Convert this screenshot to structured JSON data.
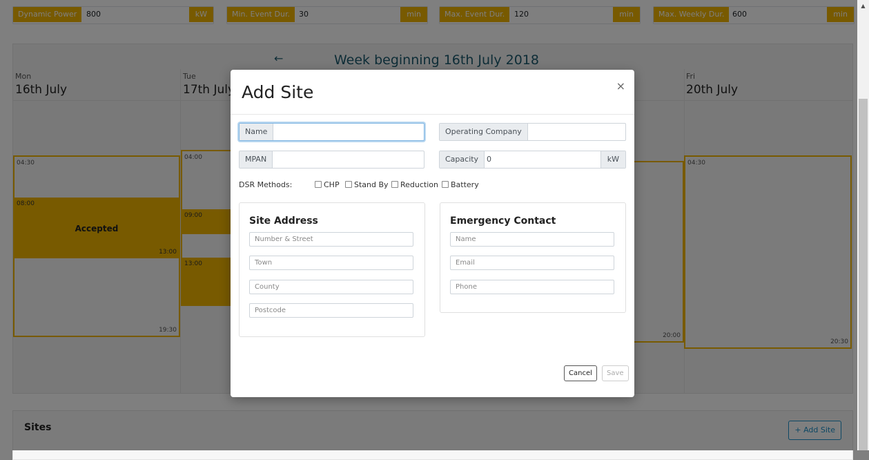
{
  "params": {
    "dynamic_power_label": "Dynamic Power",
    "dynamic_power_value": "800",
    "dynamic_power_unit": "kW",
    "min_event_label": "Min. Event Dur.",
    "min_event_value": "30",
    "min_event_unit": "min",
    "max_event_label": "Max. Event Dur.",
    "max_event_value": "120",
    "max_event_unit": "min",
    "max_weekly_label": "Max. Weekly Dur.",
    "max_weekly_value": "600",
    "max_weekly_unit": "min"
  },
  "calendar": {
    "back_arrow": "←",
    "title": "Week beginning 16th July 2018",
    "days": [
      {
        "name": "Mon",
        "date": "16th July"
      },
      {
        "name": "Tue",
        "date": "17th July"
      },
      {
        "name": "Fri",
        "date": "20th July"
      }
    ],
    "mon": {
      "e1_start": "04:30",
      "e2_start": "08:00",
      "e2_status": "Accepted",
      "e2_end": "13:00",
      "e3_end": "19:30"
    },
    "tue": {
      "e1_start": "04:00",
      "e2_start": "09:00",
      "e3_start": "13:00"
    },
    "thu": {
      "end": "20:00"
    },
    "fri": {
      "start": "04:30",
      "end": "20:30"
    }
  },
  "sites": {
    "title": "Sites",
    "add_button": "+ Add Site"
  },
  "modal": {
    "title": "Add Site",
    "close": "×",
    "name_label": "Name",
    "name_value": "",
    "operating_company_label": "Operating Company",
    "operating_company_value": "",
    "mpan_label": "MPAN",
    "mpan_value": "",
    "capacity_label": "Capacity",
    "capacity_value": "0",
    "capacity_unit": "kW",
    "dsr_label": "DSR Methods:",
    "dsr_methods": [
      "CHP",
      "Stand By",
      "Reduction",
      "Battery"
    ],
    "site_address": {
      "title": "Site Address",
      "fields": [
        "Number & Street",
        "Town",
        "County",
        "Postcode"
      ]
    },
    "emergency_contact": {
      "title": "Emergency Contact",
      "fields": [
        "Name",
        "Email",
        "Phone"
      ]
    },
    "cancel": "Cancel",
    "save": "Save"
  }
}
